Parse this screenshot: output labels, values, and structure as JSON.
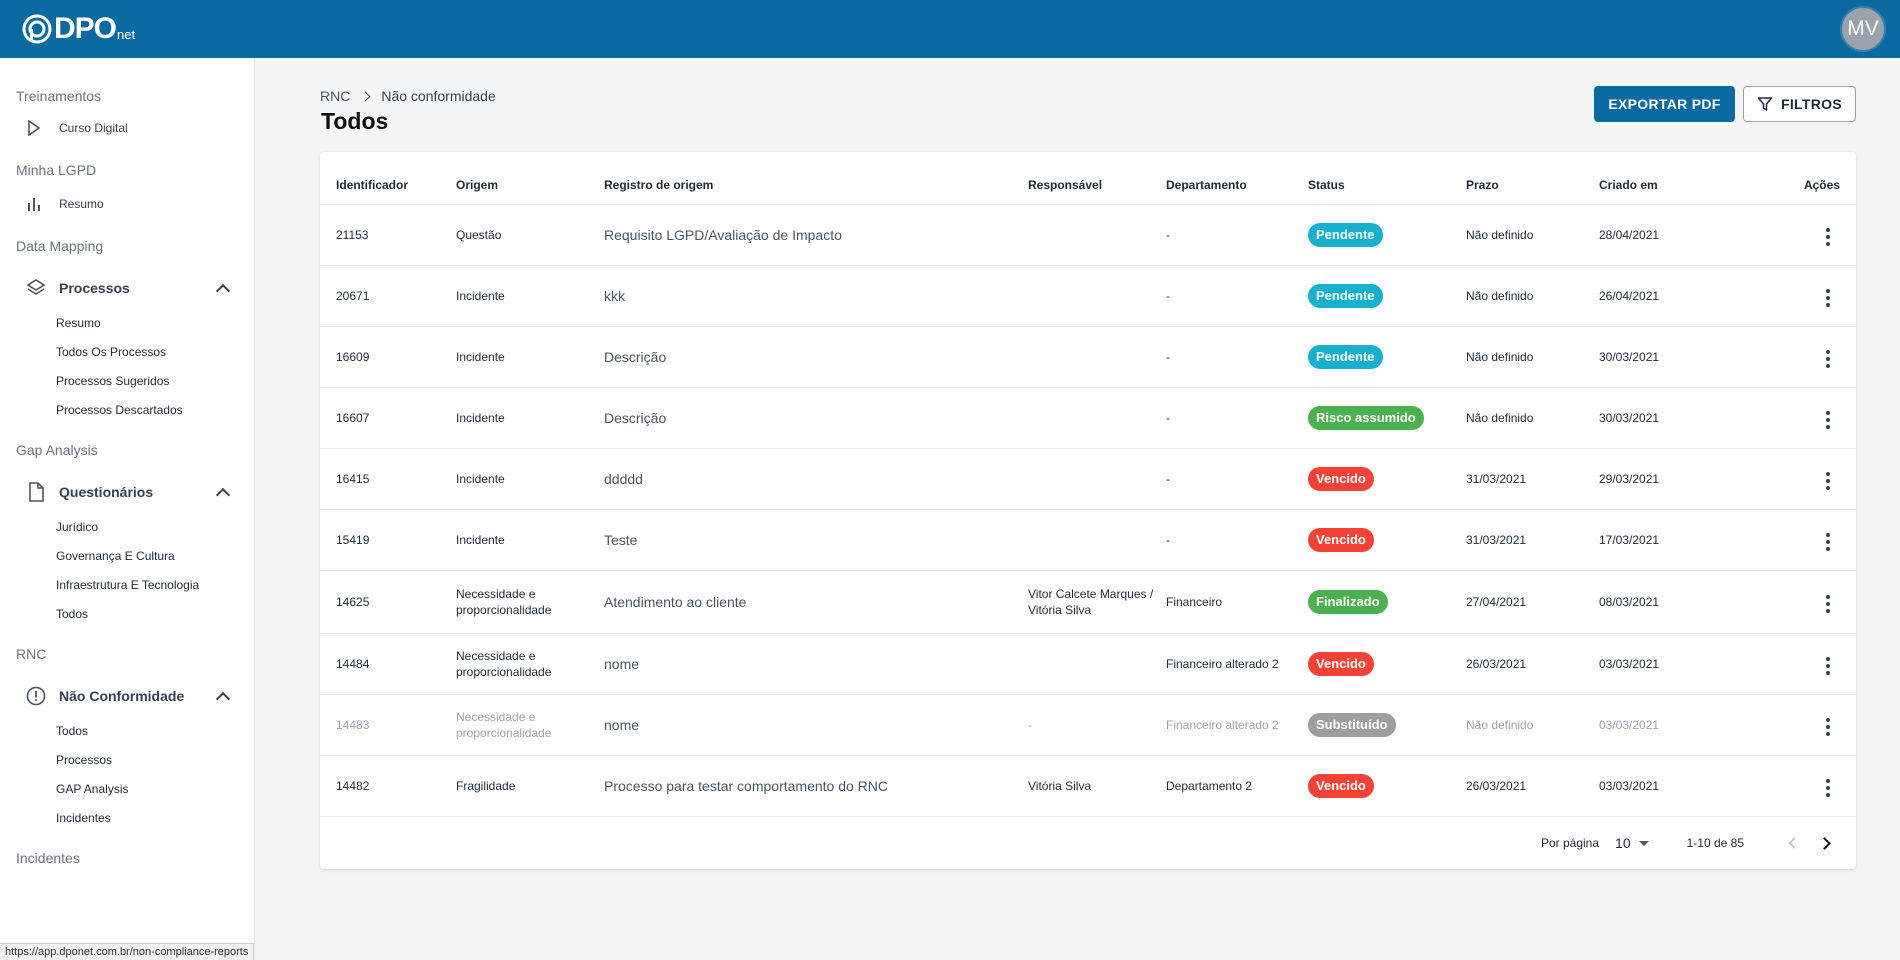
{
  "header": {
    "logo_text": "DPO",
    "logo_suffix": "net",
    "avatar_initials": "MV"
  },
  "sidebar": {
    "sections": {
      "treinamentos": "Treinamentos",
      "curso_digital": "Curso Digital",
      "minha_lgpd": "Minha LGPD",
      "resumo": "Resumo",
      "data_mapping": "Data Mapping",
      "processos": "Processos",
      "processos_items": [
        "Resumo",
        "Todos Os Processos",
        "Processos Sugeridos",
        "Processos Descartados"
      ],
      "gap_analysis": "Gap Analysis",
      "questionarios": "Questionários",
      "questionarios_items": [
        "Jurídico",
        "Governança E Cultura",
        "Infraestrutura E Tecnologia",
        "Todos"
      ],
      "rnc": "RNC",
      "nao_conformidade": "Não Conformidade",
      "nao_conformidade_items": [
        "Todos",
        "Processos",
        "GAP Analysis",
        "Incidentes"
      ],
      "incidentes": "Incidentes"
    }
  },
  "status_url": "https://app.dponet.com.br/non-compliance-reports",
  "main": {
    "breadcrumb": [
      "RNC",
      "Não conformidade"
    ],
    "title": "Todos",
    "export_label": "EXPORTAR PDF",
    "filter_label": "FILTROS"
  },
  "colors": {
    "primary": "#0b6aa2",
    "pendente": "#17b1cf",
    "risco": "#4caf50",
    "vencido": "#f44336",
    "finalizado": "#4caf50",
    "substituido": "#9e9e9e"
  },
  "table": {
    "columns": [
      "Identificador",
      "Origem",
      "Registro de origem",
      "Responsável",
      "Departamento",
      "Status",
      "Prazo",
      "Criado em",
      "Ações"
    ],
    "rows": [
      {
        "id": "21153",
        "origem": "Questão",
        "registro": "Requisito LGPD/Avaliação de Impacto",
        "responsavel": "",
        "departamento": "-",
        "status": "Pendente",
        "status_color": "#17b1cf",
        "prazo": "Não definido",
        "criado": "28/04/2021",
        "muted": false
      },
      {
        "id": "20671",
        "origem": "Incidente",
        "registro": "kkk",
        "responsavel": "",
        "departamento": "-",
        "status": "Pendente",
        "status_color": "#17b1cf",
        "prazo": "Não definido",
        "criado": "26/04/2021",
        "muted": false
      },
      {
        "id": "16609",
        "origem": "Incidente",
        "registro": "Descrição",
        "responsavel": "",
        "departamento": "-",
        "status": "Pendente",
        "status_color": "#17b1cf",
        "prazo": "Não definido",
        "criado": "30/03/2021",
        "muted": false
      },
      {
        "id": "16607",
        "origem": "Incidente",
        "registro": "Descrição",
        "responsavel": "",
        "departamento": "-",
        "status": "Risco assumido",
        "status_color": "#4caf50",
        "prazo": "Não definido",
        "criado": "30/03/2021",
        "muted": false
      },
      {
        "id": "16415",
        "origem": "Incidente",
        "registro": "ddddd",
        "responsavel": "",
        "departamento": "-",
        "status": "Vencido",
        "status_color": "#f44336",
        "prazo": "31/03/2021",
        "criado": "29/03/2021",
        "muted": false
      },
      {
        "id": "15419",
        "origem": "Incidente",
        "registro": "Teste",
        "responsavel": "",
        "departamento": "-",
        "status": "Vencido",
        "status_color": "#f44336",
        "prazo": "31/03/2021",
        "criado": "17/03/2021",
        "muted": false
      },
      {
        "id": "14625",
        "origem": "Necessidade e proporcionalidade",
        "registro": "Atendimento ao cliente",
        "responsavel": "Vitor Calcete Marques / Vitória Silva",
        "departamento": "Financeiro",
        "status": "Finalizado",
        "status_color": "#4caf50",
        "prazo": "27/04/2021",
        "criado": "08/03/2021",
        "muted": false
      },
      {
        "id": "14484",
        "origem": "Necessidade e proporcionalidade",
        "registro": "nome",
        "responsavel": "",
        "departamento": "Financeiro alterado 2",
        "status": "Vencido",
        "status_color": "#f44336",
        "prazo": "26/03/2021",
        "criado": "03/03/2021",
        "muted": false
      },
      {
        "id": "14483",
        "origem": "Necessidade e proporcionalidade",
        "registro": "nome",
        "responsavel": "-",
        "departamento": "Financeiro alterado 2",
        "status": "Substituído",
        "status_color": "#9e9e9e",
        "prazo": "Não definido",
        "criado": "03/03/2021",
        "muted": true
      },
      {
        "id": "14482",
        "origem": "Fragilidade",
        "registro": "Processo para testar comportamento do RNC",
        "responsavel": "Vitória Silva",
        "departamento": "Departamento 2",
        "status": "Vencido",
        "status_color": "#f44336",
        "prazo": "26/03/2021",
        "criado": "03/03/2021",
        "muted": false
      }
    ]
  },
  "pagination": {
    "per_page_label": "Por página",
    "per_page_value": "10",
    "range": "1-10 de 85"
  }
}
